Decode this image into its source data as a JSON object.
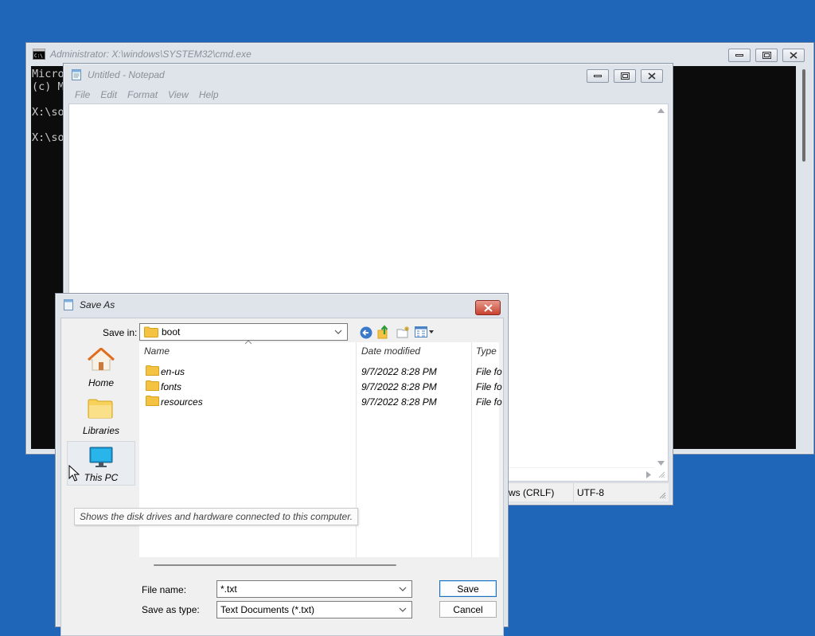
{
  "cmd": {
    "title": "Administrator: X:\\windows\\SYSTEM32\\cmd.exe",
    "lines": [
      "Micro",
      "(c) M",
      "",
      "X:\\so",
      "",
      "X:\\so"
    ]
  },
  "notepad": {
    "title": "Untitled - Notepad",
    "menu": [
      "File",
      "Edit",
      "Format",
      "View",
      "Help"
    ],
    "status": {
      "line_ending": "ws (CRLF)",
      "encoding": "UTF-8"
    }
  },
  "save_as": {
    "title": "Save As",
    "save_in_label": "Save in:",
    "save_in_value": "boot",
    "places": [
      {
        "label": "Home",
        "icon": "home-icon"
      },
      {
        "label": "Libraries",
        "icon": "libraries-icon"
      },
      {
        "label": "This PC",
        "icon": "this-pc-icon"
      }
    ],
    "tooltip": "Shows the disk drives and hardware connected to this computer.",
    "columns": [
      "Name",
      "Date modified",
      "Type"
    ],
    "files": [
      {
        "name": "en-us",
        "date": "9/7/2022 8:28 PM",
        "type": "File fo"
      },
      {
        "name": "fonts",
        "date": "9/7/2022 8:28 PM",
        "type": "File fo"
      },
      {
        "name": "resources",
        "date": "9/7/2022 8:28 PM",
        "type": "File fo"
      }
    ],
    "file_name_label": "File name:",
    "file_name_value": "*.txt",
    "save_as_type_label": "Save as type:",
    "save_as_type_value": "Text Documents (*.txt)",
    "save_button": "Save",
    "cancel_button": "Cancel"
  },
  "colors": {
    "desktop": "#1f66b8",
    "console_bg": "#0c0c0c",
    "close_red": "#c7432f",
    "default_button_border": "#1c6fbd",
    "folder_yellow": "#f5c342"
  }
}
